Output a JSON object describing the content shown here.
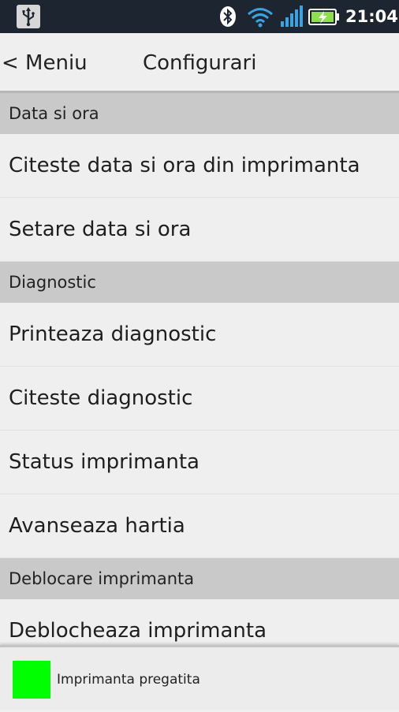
{
  "statusbar": {
    "time": "21:04",
    "icons": [
      "usb-icon",
      "bluetooth-icon",
      "wifi-icon",
      "signal-icon",
      "battery-charging-icon"
    ]
  },
  "titlebar": {
    "back_label": "< Meniu",
    "title": "Configurari"
  },
  "sections": [
    {
      "header": "Data si ora",
      "items": [
        "Citeste data si ora din imprimanta",
        "Setare data si ora"
      ]
    },
    {
      "header": "Diagnostic",
      "items": [
        "Printeaza diagnostic",
        "Citeste diagnostic",
        "Status imprimanta",
        "Avanseaza hartia"
      ]
    },
    {
      "header": "Deblocare imprimanta",
      "items": [
        "Deblocheaza imprimanta"
      ]
    }
  ],
  "footer": {
    "status_text": "Imprimanta pregatita",
    "status_color": "#00ff00"
  },
  "colors": {
    "statusbar_bg": "#1c2530",
    "accent_blue": "#3aa3e3",
    "battery_green": "#8be04b"
  }
}
